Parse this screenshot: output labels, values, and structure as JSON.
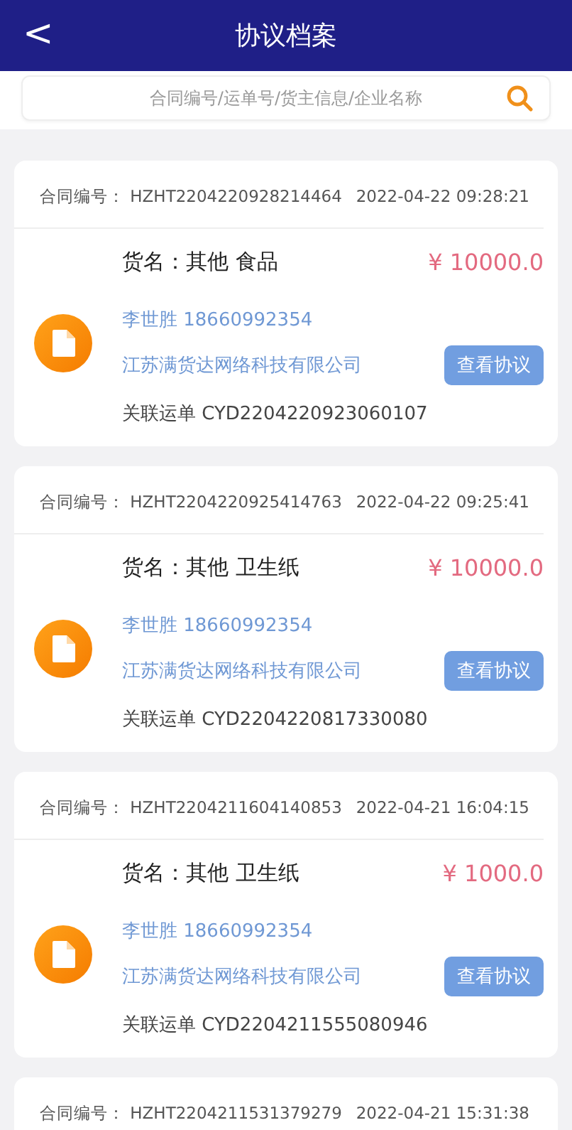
{
  "header": {
    "back": "<",
    "title": "协议档案"
  },
  "search": {
    "placeholder": "合同编号/运单号/货主信息/企业名称"
  },
  "contracts": [
    {
      "label": "合同编号：",
      "number": "HZHT2204220928214464",
      "time": "2022-04-22 09:28:21",
      "goods": "货名：其他 食品",
      "price": "¥ 10000.0",
      "contact": "李世胜 18660992354",
      "company": "江苏满货达网络科技有限公司",
      "button": "查看协议",
      "waybill": "关联运单 CYD2204220923060107"
    },
    {
      "label": "合同编号：",
      "number": "HZHT2204220925414763",
      "time": "2022-04-22 09:25:41",
      "goods": "货名：其他 卫生纸",
      "price": "¥ 10000.0",
      "contact": "李世胜 18660992354",
      "company": "江苏满货达网络科技有限公司",
      "button": "查看协议",
      "waybill": "关联运单 CYD2204220817330080"
    },
    {
      "label": "合同编号：",
      "number": "HZHT2204211604140853",
      "time": "2022-04-21 16:04:15",
      "goods": "货名：其他 卫生纸",
      "price": "¥ 1000.0",
      "contact": "李世胜 18660992354",
      "company": "江苏满货达网络科技有限公司",
      "button": "查看协议",
      "waybill": "关联运单 CYD2204211555080946"
    },
    {
      "label": "合同编号：",
      "number": "HZHT2204211531379279",
      "time": "2022-04-21 15:31:38"
    }
  ]
}
